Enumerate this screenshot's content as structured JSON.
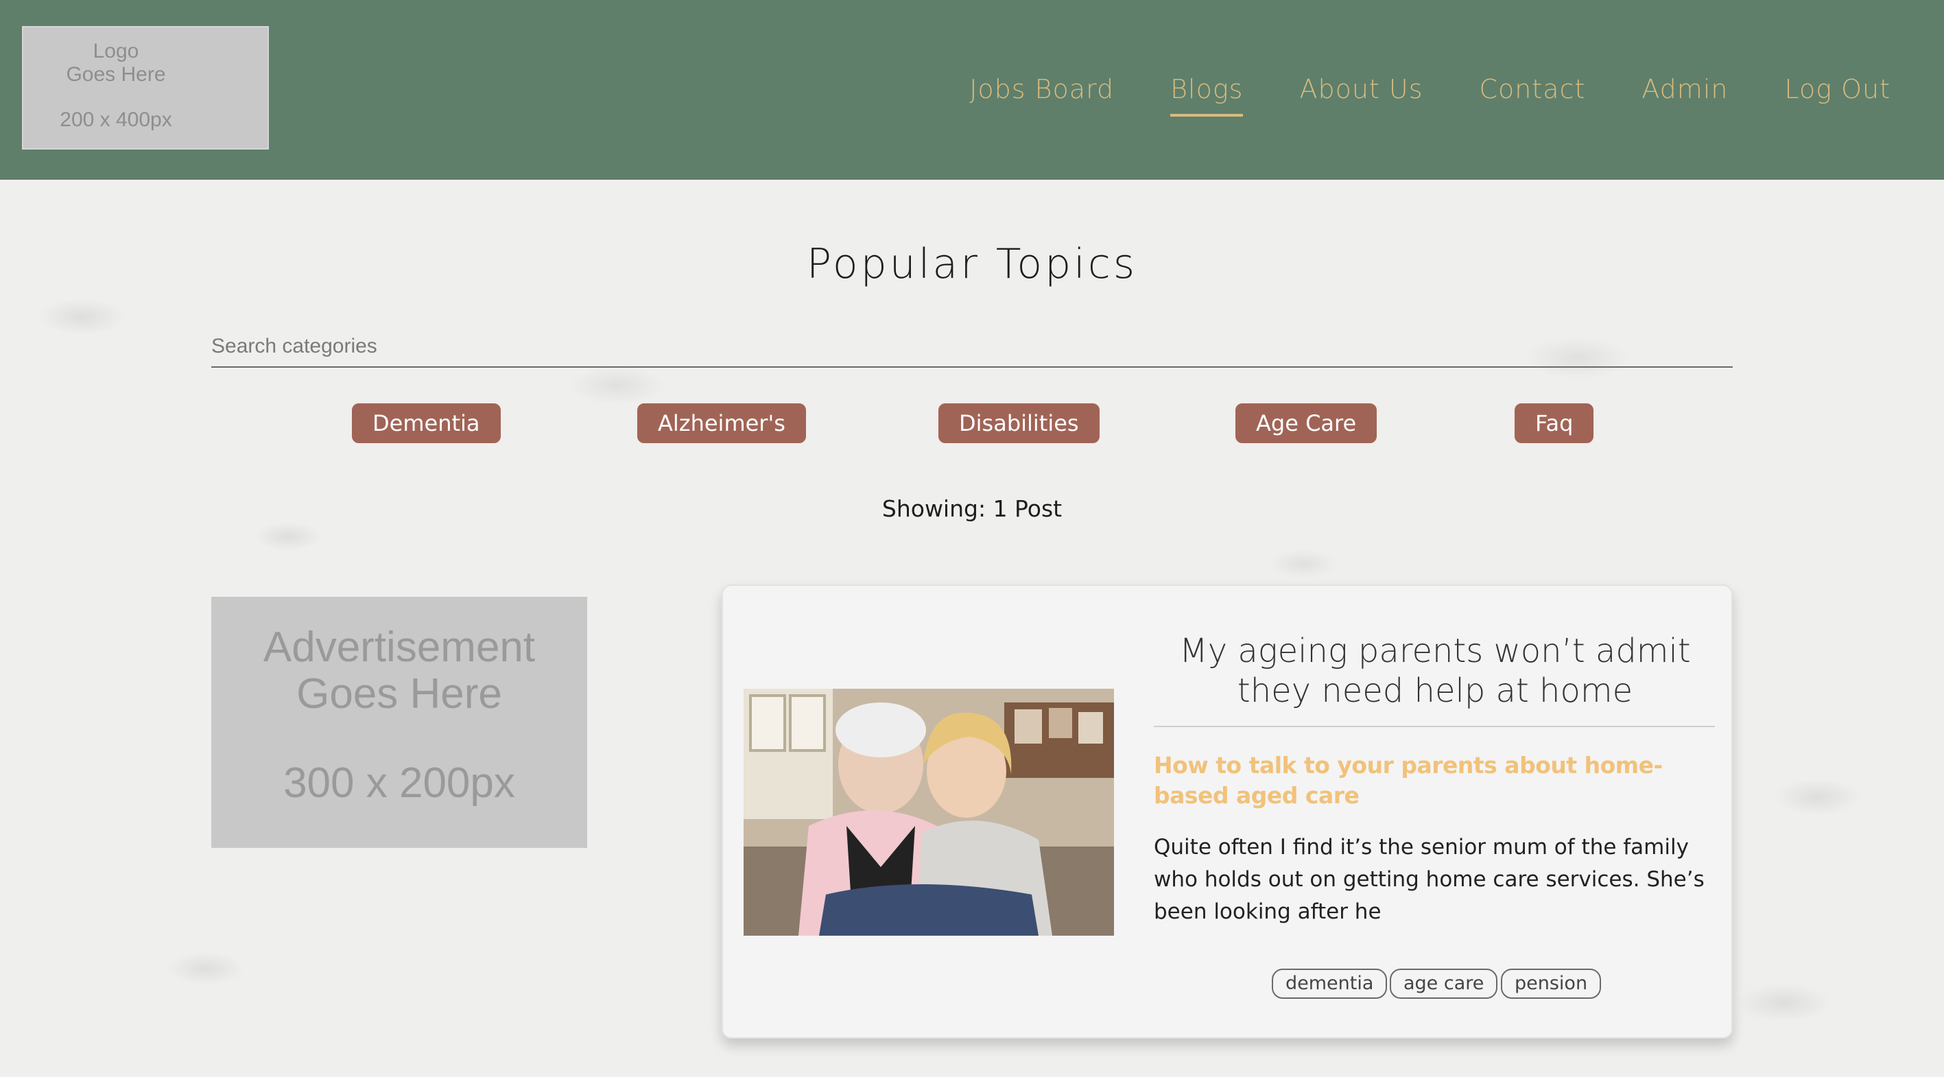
{
  "header": {
    "logo": {
      "line1": "Logo",
      "line2": "Goes Here",
      "size": "200 x 400px"
    },
    "nav": [
      {
        "label": "Jobs Board",
        "active": false
      },
      {
        "label": "Blogs",
        "active": true
      },
      {
        "label": "About Us",
        "active": false
      },
      {
        "label": "Contact",
        "active": false
      },
      {
        "label": "Admin",
        "active": false
      },
      {
        "label": "Log Out",
        "active": false
      }
    ]
  },
  "main": {
    "title": "Popular Topics",
    "search": {
      "placeholder": "Search categories",
      "value": ""
    },
    "categories": [
      "Dementia",
      "Alzheimer's",
      "Disabilities",
      "Age Care",
      "Faq"
    ],
    "showing": "Showing: 1 Post"
  },
  "ad": {
    "line1": "Advertisement",
    "line2": "Goes Here",
    "size": "300 x 200px"
  },
  "post": {
    "title": "My ageing parents won’t admit they need help at home",
    "subtitle": "How to talk to your parents about home-based aged care",
    "excerpt": "Quite often I find it’s the senior mum of the family who holds out on getting home care services. She’s been looking after he",
    "tags": [
      "dementia",
      "age care",
      "pension"
    ]
  },
  "colors": {
    "header_bg": "#5f7f6b",
    "nav_text": "#d8bb7e",
    "category_bg": "#a06456",
    "subtitle": "#f1c27a"
  }
}
